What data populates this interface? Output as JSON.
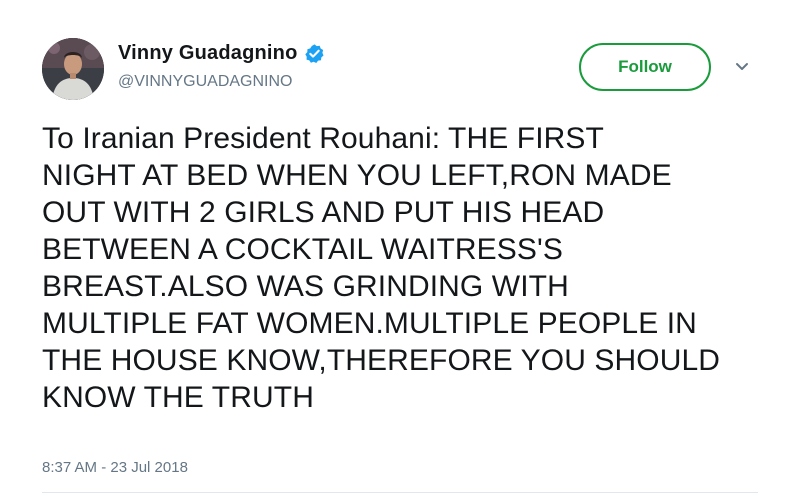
{
  "header": {
    "display_name": "Vinny Guadagnino",
    "handle": "@VINNYGUADAGNINO",
    "verified_icon": "verified-badge-icon",
    "avatar": "avatar-photo",
    "follow_label": "Follow",
    "menu_icon": "chevron-down-icon"
  },
  "tweet": {
    "text": "To Iranian President Rouhani: THE FIRST\nNIGHT AT BED WHEN YOU LEFT,RON MADE\nOUT WITH 2 GIRLS AND PUT HIS HEAD\nBETWEEN A COCKTAIL WAITRESS'S\nBREAST.ALSO WAS GRINDING WITH\nMULTIPLE FAT WOMEN.MULTIPLE PEOPLE IN\nTHE HOUSE KNOW,THEREFORE YOU SHOULD\nKNOW THE TRUTH",
    "timestamp": "8:37 AM - 23 Jul 2018"
  },
  "colors": {
    "follow_green": "#1a9b3c",
    "verified_blue": "#1da1f2",
    "secondary_text": "#657786",
    "primary_text": "#14171a"
  }
}
